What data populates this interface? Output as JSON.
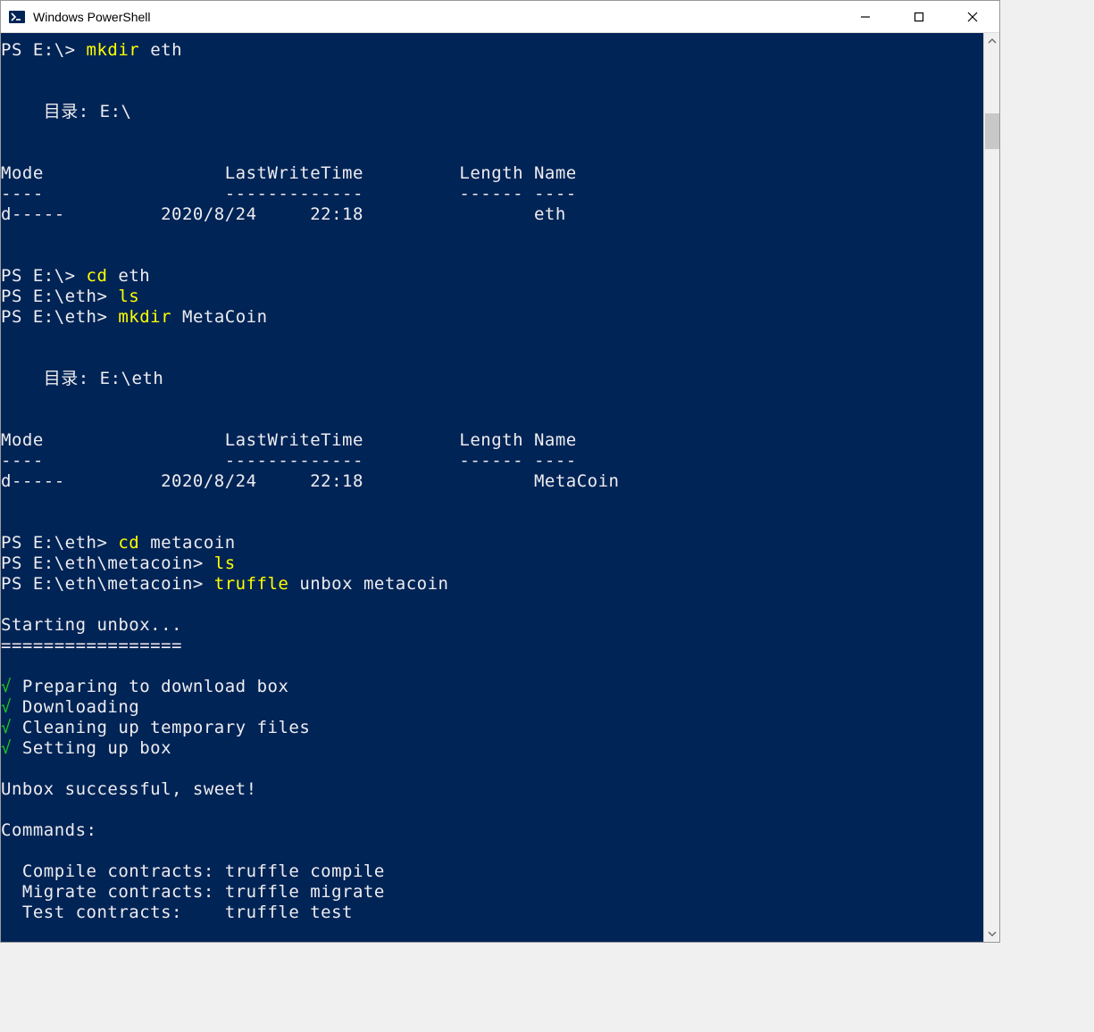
{
  "window": {
    "title": "Windows PowerShell"
  },
  "ps": {
    "root_prompt": "PS E:\\>",
    "eth_prompt": "PS E:\\eth>",
    "metacoin_prompt": "PS E:\\eth\\metacoin>"
  },
  "cmds": {
    "mkdir": "mkdir",
    "cd": "cd",
    "ls": "ls",
    "truffle": "truffle"
  },
  "args": {
    "eth": "eth",
    "MetaCoin": "MetaCoin",
    "metacoin": "metacoin",
    "unbox_metacoin": "unbox metacoin"
  },
  "dir": {
    "label1": "    目录: E:\\",
    "label2": "    目录: E:\\eth"
  },
  "table": {
    "header": "Mode                 LastWriteTime         Length Name",
    "divider": "----                 -------------         ------ ----",
    "row_eth": "d-----         2020/8/24     22:18                eth",
    "row_mc": "d-----         2020/8/24     22:18                MetaCoin"
  },
  "unbox": {
    "starting": "Starting unbox...",
    "divider": "=================",
    "check": "√",
    "step1": "Preparing to download box",
    "step2": "Downloading",
    "step3": "Cleaning up temporary files",
    "step4": "Setting up box",
    "success": "Unbox successful, sweet!",
    "commands_label": "Commands:",
    "compile": "  Compile contracts: truffle compile",
    "migrate": "  Migrate contracts: truffle migrate",
    "test": "  Test contracts:    truffle test"
  }
}
